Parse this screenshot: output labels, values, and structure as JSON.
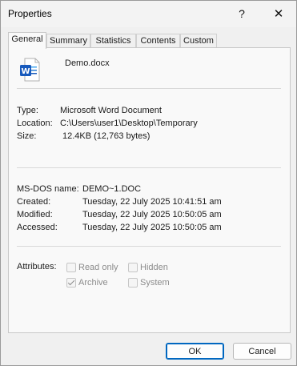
{
  "window": {
    "title": "Properties",
    "help_glyph": "?",
    "close_glyph": "✕"
  },
  "tabs": [
    {
      "label": "General",
      "active": true
    },
    {
      "label": "Summary",
      "active": false
    },
    {
      "label": "Statistics",
      "active": false
    },
    {
      "label": "Contents",
      "active": false
    },
    {
      "label": "Custom",
      "active": false
    }
  ],
  "file": {
    "name": "Demo.docx",
    "icon": "word-document-icon",
    "icon_letter": "W",
    "icon_color": "#185abd"
  },
  "details": {
    "type_label": "Type:",
    "type_value": "Microsoft Word Document",
    "location_label": "Location:",
    "location_value": "C:\\Users\\user1\\Desktop\\Temporary",
    "size_label": "Size:",
    "size_value": "12.4KB (12,763 bytes)"
  },
  "dates": {
    "msdos_label": "MS-DOS name:",
    "msdos_value": "DEMO~1.DOC",
    "created_label": "Created:",
    "created_value": "Tuesday, 22 July 2025 10:41:51 am",
    "modified_label": "Modified:",
    "modified_value": "Tuesday, 22 July 2025 10:50:05 am",
    "accessed_label": "Accessed:",
    "accessed_value": "Tuesday, 22 July 2025 10:50:05 am"
  },
  "attributes": {
    "label": "Attributes:",
    "read_only": {
      "label": "Read only",
      "checked": false
    },
    "hidden": {
      "label": "Hidden",
      "checked": false
    },
    "archive": {
      "label": "Archive",
      "checked": true
    },
    "system": {
      "label": "System",
      "checked": false
    }
  },
  "buttons": {
    "ok": "OK",
    "cancel": "Cancel"
  }
}
